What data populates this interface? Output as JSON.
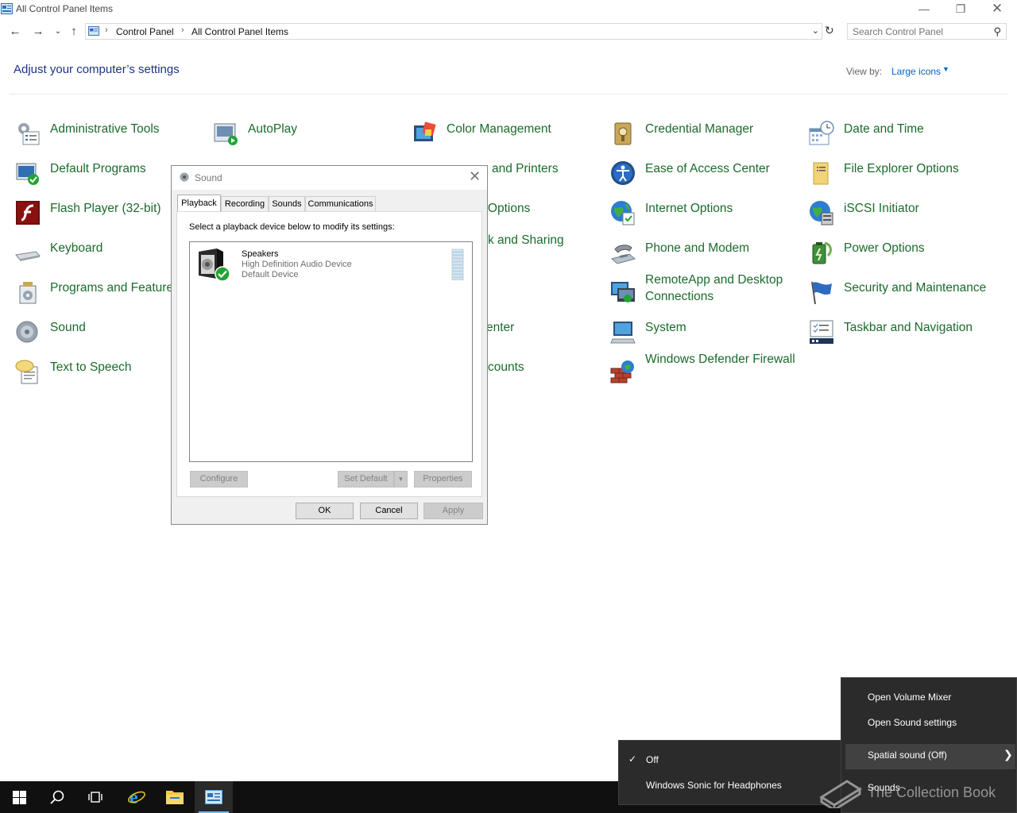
{
  "window": {
    "title": "All Control Panel Items",
    "minimize_icon": "minimize-icon",
    "maximize_icon": "restore-icon",
    "close_icon": "close-icon"
  },
  "address_bar": {
    "breadcrumbs": [
      "Control Panel",
      "All Control Panel Items"
    ],
    "search_placeholder": "Search Control Panel"
  },
  "header": {
    "heading": "Adjust your computer’s settings",
    "view_by_label": "View by:",
    "view_by_value": "Large icons"
  },
  "items": [
    {
      "label": "Administrative Tools",
      "icon": "admin-tools-icon"
    },
    {
      "label": "AutoPlay",
      "icon": "autoplay-icon"
    },
    {
      "label": "Color Management",
      "icon": "color-management-icon"
    },
    {
      "label": "Credential Manager",
      "icon": "credential-manager-icon"
    },
    {
      "label": "Date and Time",
      "icon": "date-time-icon"
    },
    {
      "label": "Default Programs",
      "icon": "default-programs-icon"
    },
    {
      "label": "and Printers",
      "icon": "devices-printers-icon"
    },
    {
      "label": "Ease of Access Center",
      "icon": "ease-of-access-icon"
    },
    {
      "label": "File Explorer Options",
      "icon": "file-explorer-options-icon"
    },
    {
      "label": "Flash Player (32-bit)",
      "icon": "flash-player-icon"
    },
    {
      "label": "g Options",
      "icon": "indexing-options-icon"
    },
    {
      "label": "Internet Options",
      "icon": "internet-options-icon"
    },
    {
      "label": "iSCSI Initiator",
      "icon": "iscsi-icon"
    },
    {
      "label": "Keyboard",
      "icon": "keyboard-icon"
    },
    {
      "label": "k and Sharing",
      "icon": "network-sharing-icon"
    },
    {
      "label": "Phone and Modem",
      "icon": "phone-modem-icon"
    },
    {
      "label": "Power Options",
      "icon": "power-options-icon"
    },
    {
      "label": "Programs and Feature",
      "icon": "programs-features-icon"
    },
    {
      "label": "RemoteApp and Desktop Connections",
      "icon": "remoteapp-icon"
    },
    {
      "label": "Security and Maintenance",
      "icon": "security-flag-icon"
    },
    {
      "label": "Sound",
      "icon": "sound-icon"
    },
    {
      "label": "enter",
      "icon": "sync-center-icon"
    },
    {
      "label": "System",
      "icon": "system-icon"
    },
    {
      "label": "Taskbar and Navigation",
      "icon": "taskbar-nav-icon"
    },
    {
      "label": "Text to Speech",
      "icon": "text-to-speech-icon"
    },
    {
      "label": "counts",
      "icon": "user-accounts-icon"
    },
    {
      "label": "Windows Defender Firewall",
      "icon": "firewall-icon"
    }
  ],
  "sound_dialog": {
    "title": "Sound",
    "tabs": [
      "Playback",
      "Recording",
      "Sounds",
      "Communications"
    ],
    "instruction": "Select a playback device below to modify its settings:",
    "device": {
      "name": "Speakers",
      "description": "High Definition Audio Device",
      "status": "Default Device",
      "level": 0
    },
    "buttons": {
      "configure": "Configure",
      "set_default": "Set Default",
      "properties": "Properties",
      "ok": "OK",
      "cancel": "Cancel",
      "apply": "Apply"
    }
  },
  "tray_menu": {
    "items": [
      "Open Volume Mixer",
      "Open Sound settings",
      "Spatial sound (Off)",
      "Sounds"
    ],
    "submenu": [
      "Off",
      "Windows Sonic for Headphones"
    ]
  },
  "taskbar": {
    "icons": [
      "start-icon",
      "search-icon",
      "task-view-icon",
      "internet-explorer-icon",
      "file-explorer-icon",
      "control-panel-icon"
    ]
  },
  "watermark": {
    "text": "The Collection Book"
  },
  "colors": {
    "link_green": "#1b6b2c",
    "heading_blue": "#1e3287",
    "taskbar": "#101010",
    "menu_bg": "#2b2b2b"
  }
}
